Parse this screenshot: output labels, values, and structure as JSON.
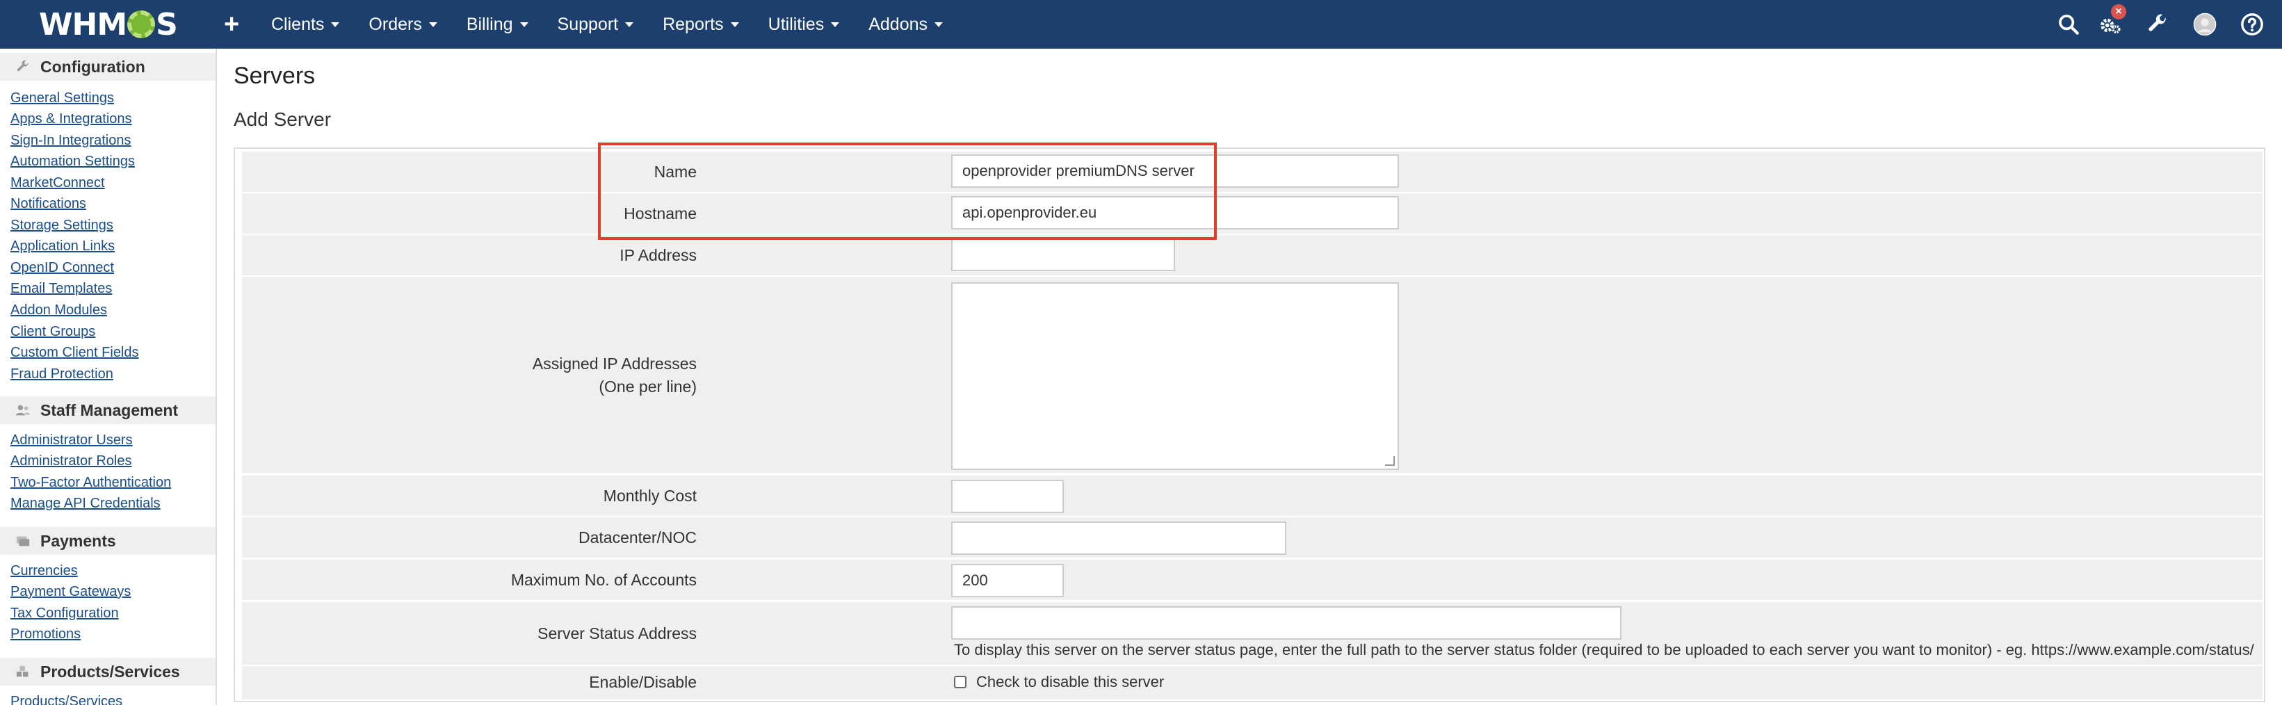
{
  "app": {
    "logo_text_left": "WHM",
    "logo_text_right": "S"
  },
  "topnav": {
    "plus_label": "+",
    "menu": [
      {
        "label": "Clients"
      },
      {
        "label": "Orders"
      },
      {
        "label": "Billing"
      },
      {
        "label": "Support"
      },
      {
        "label": "Reports"
      },
      {
        "label": "Utilities"
      },
      {
        "label": "Addons"
      }
    ],
    "icons": [
      "search-icon",
      "gear-icon",
      "wrench-icon",
      "avatar",
      "help-icon"
    ],
    "notification_badge": "×"
  },
  "sidebar": {
    "sections": [
      {
        "title": "Configuration",
        "icon": "wrench-icon",
        "links": [
          "General Settings",
          "Apps & Integrations",
          "Sign-In Integrations",
          "Automation Settings",
          "MarketConnect",
          "Notifications",
          "Storage Settings",
          "Application Links",
          "OpenID Connect",
          "Email Templates",
          "Addon Modules",
          "Client Groups",
          "Custom Client Fields",
          "Fraud Protection"
        ]
      },
      {
        "title": "Staff Management",
        "icon": "users-icon",
        "links": [
          "Administrator Users",
          "Administrator Roles",
          "Two-Factor Authentication",
          "Manage API Credentials"
        ]
      },
      {
        "title": "Payments",
        "icon": "payments-icon",
        "links": [
          "Currencies",
          "Payment Gateways",
          "Tax Configuration",
          "Promotions"
        ]
      },
      {
        "title": "Products/Services",
        "icon": "cubes-icon",
        "links": [
          "Products/Services"
        ]
      }
    ]
  },
  "main": {
    "page_title": "Servers",
    "section_title": "Add Server",
    "form": {
      "name_label": "Name",
      "name_value": "openprovider premiumDNS server",
      "hostname_label": "Hostname",
      "hostname_value": "api.openprovider.eu",
      "ip_label": "IP Address",
      "ip_value": "",
      "assigned_ips_label_1": "Assigned IP Addresses",
      "assigned_ips_label_2": "(One per line)",
      "monthly_cost_label": "Monthly Cost",
      "monthly_cost_value": "",
      "datacenter_label": "Datacenter/NOC",
      "datacenter_value": "",
      "max_accounts_label": "Maximum No. of Accounts",
      "max_accounts_value": "200",
      "status_address_label": "Server Status Address",
      "status_address_value": "",
      "status_address_hint": "To display this server on the server status page, enter the full path to the server status folder (required to be uploaded to each server you want to monitor) - eg. https://www.example.com/status/",
      "enable_label": "Enable/Disable",
      "disable_checkbox_label": "Check to disable this server"
    }
  },
  "colors": {
    "nav_bg": "#1c3f6d",
    "highlight": "#e0402a",
    "link": "#1a4e8a"
  }
}
